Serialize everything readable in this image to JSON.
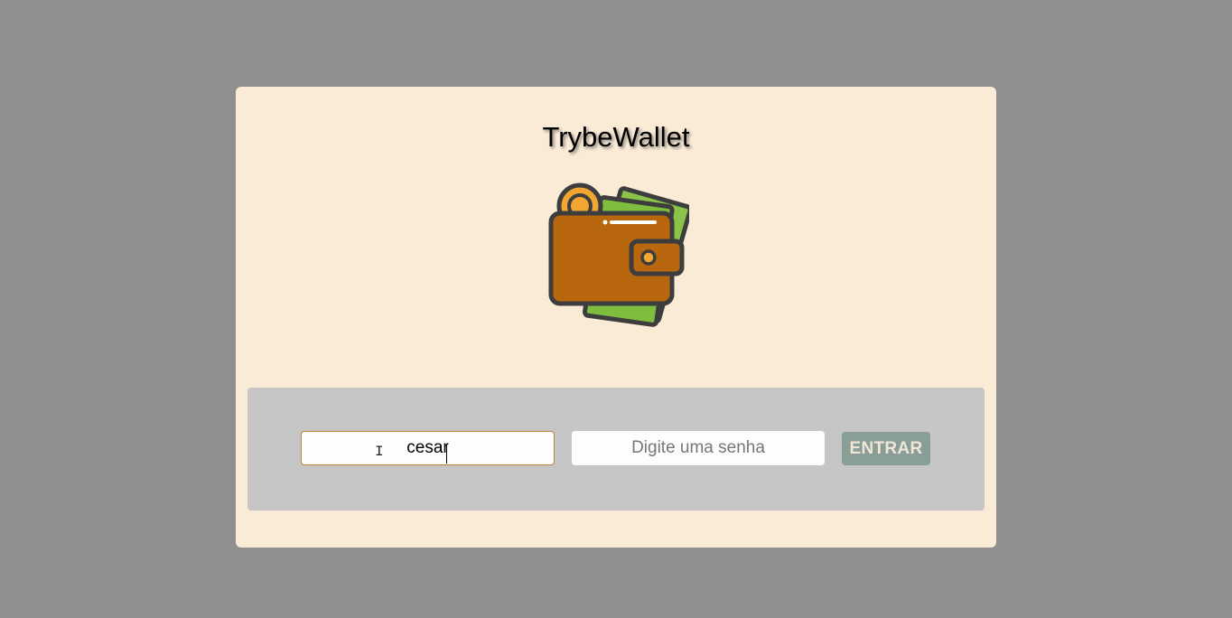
{
  "app": {
    "title": "TrybeWallet"
  },
  "logo": {
    "icon": "wallet-icon",
    "colors": {
      "wallet": "#b8670e",
      "coin": "#f0a630",
      "cash": "#8bc34a",
      "outline": "#3d3d3d"
    }
  },
  "form": {
    "email": {
      "value": "cesar",
      "placeholder": ""
    },
    "password": {
      "value": "",
      "placeholder": "Digite uma senha"
    },
    "submit_label": "ENTRAR"
  },
  "colors": {
    "page_background": "#8f8f8f",
    "card_background": "#faebd7",
    "form_panel": "#c6c6c6",
    "button": "#8a9e98",
    "button_text": "#efe6d6",
    "focus_border": "#b8863b"
  }
}
